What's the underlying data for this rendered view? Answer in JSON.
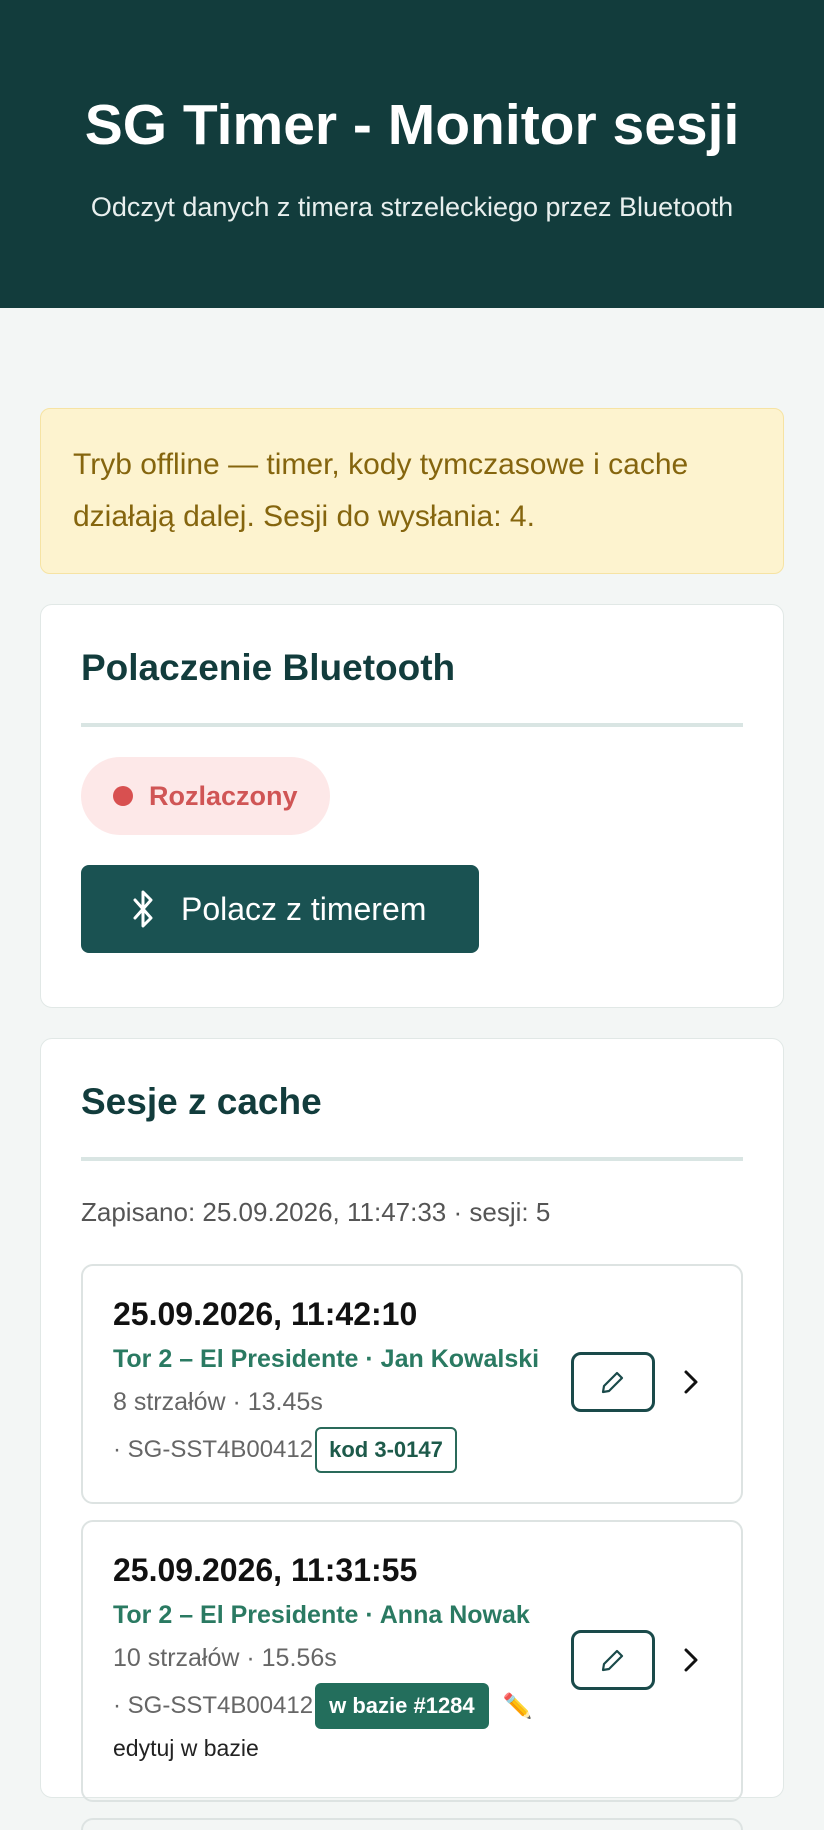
{
  "header": {
    "title": "SG Timer - Monitor sesji",
    "subtitle": "Odczyt danych z timera strzeleckiego przez Bluetooth"
  },
  "offline_alert": {
    "text": "Tryb offline — timer, kody tymczasowe i cache działają dalej. Sesji do wysłania: 4."
  },
  "bluetooth": {
    "heading": "Polaczenie Bluetooth",
    "status": "Rozlaczony",
    "status_color": "#d85050",
    "connect_label": "Polacz z timerem"
  },
  "cache": {
    "heading": "Sesje z cache",
    "saved_info": "Zapisano: 25.09.2026, 11:47:33 · sesji: 5",
    "sessions": [
      {
        "date": "25.09.2026, 11:42:10",
        "title": "Tor 2 – El Presidente · Jan Kowalski",
        "meta": "8 strzałów · 13.45s",
        "device": "· SG-SST4B00412",
        "badge": "kod 3-0147"
      },
      {
        "date": "25.09.2026, 11:31:55",
        "title": "Tor 2 – El Presidente · Anna Nowak",
        "meta": "10 strzałów · 15.56s",
        "device": "· SG-SST4B00412",
        "badge": "w bazie #1284",
        "pencil": "✏️",
        "edit_label": "edytuj w bazie"
      }
    ]
  },
  "colors": {
    "header_bg": "#123c3c",
    "accent": "#1a5252",
    "title_green": "#2a7a62",
    "alert_bg": "#fdf3cf"
  }
}
